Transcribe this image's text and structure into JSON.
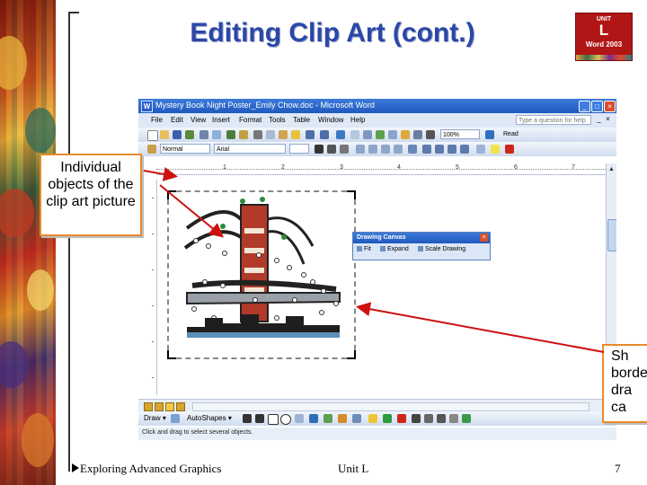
{
  "slide": {
    "title": "Editing Clip Art (cont.)",
    "badge": {
      "line1": "UNIT",
      "line2": "L",
      "line3": "Word 2003"
    }
  },
  "word": {
    "title": "Mystery Book Night Poster_Emily Chow.doc - Microsoft Word",
    "app_icon": "W",
    "menu": [
      "File",
      "Edit",
      "View",
      "Insert",
      "Format",
      "Tools",
      "Table",
      "Window",
      "Help"
    ],
    "help_placeholder": "Type a question for help",
    "style_value": "Normal",
    "font_value": "Arial",
    "zoom_value": "100%",
    "read_label": "Read",
    "ruler_numbers": [
      "1",
      "2",
      "3",
      "4",
      "5",
      "6",
      "7"
    ],
    "drawing_canvas": {
      "title": "Drawing Canvas",
      "buttons": [
        "Fit",
        "Expand",
        "Scale Drawing"
      ]
    },
    "draw_toolbar": {
      "draw_label": "Draw ▾",
      "autoshapes_label": "AutoShapes ▾"
    },
    "status_text": "Click and drag to select several objects."
  },
  "callouts": {
    "left_text": "Individual objects of the clip art picture",
    "right_lines": [
      "Sh",
      "borde",
      "dra",
      "ca"
    ]
  },
  "footer": {
    "left": "Exploring Advanced Graphics",
    "center": "Unit L",
    "page": "7"
  },
  "icons": {
    "arrow_color": "#cc1111",
    "accent": "#2b47a8",
    "callout_border": "#e98a2b"
  }
}
